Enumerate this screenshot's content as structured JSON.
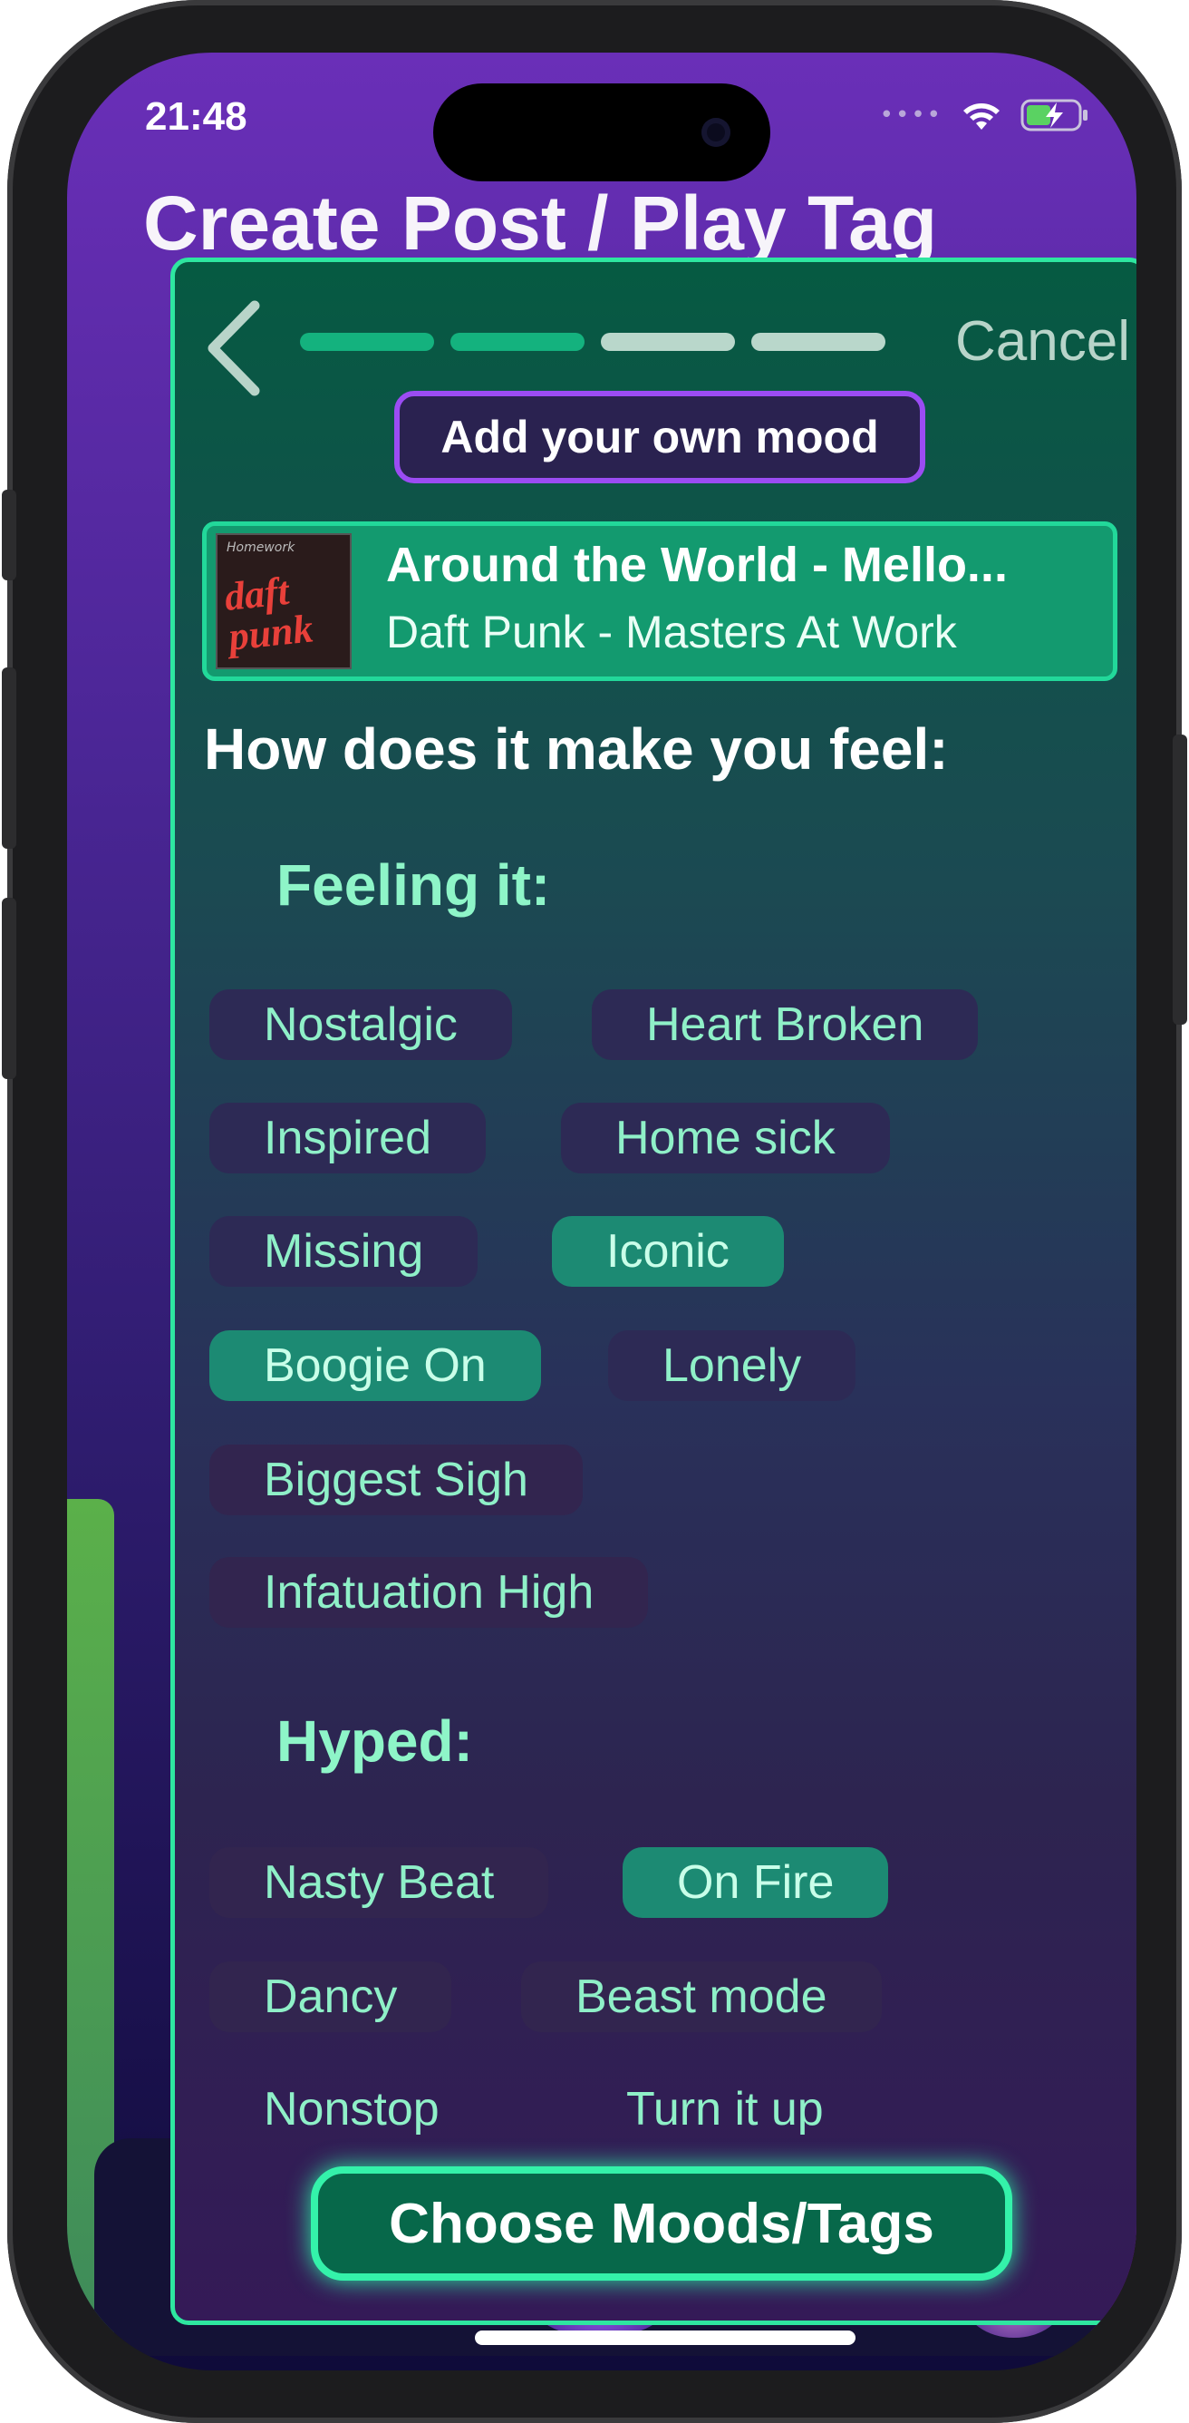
{
  "status_bar": {
    "time": "21:48"
  },
  "background": {
    "title": "Create Post / Play Tag"
  },
  "modal": {
    "cancel_label": "Cancel",
    "progress": {
      "total_steps": 4,
      "completed_steps": 2
    },
    "add_mood_label": "Add your own mood",
    "song": {
      "title": "Around the World - Mello...",
      "subtitle": "Daft Punk - Masters At Work",
      "album_art_text": "daft punk"
    },
    "question": "How does it make you feel:",
    "sections": [
      {
        "title": "Feeling it:",
        "chips": [
          {
            "label": "Nostalgic",
            "selected": false
          },
          {
            "label": "Heart Broken",
            "selected": false
          },
          {
            "label": "Inspired",
            "selected": false
          },
          {
            "label": "Home sick",
            "selected": false
          },
          {
            "label": "Missing",
            "selected": false
          },
          {
            "label": "Iconic",
            "selected": true
          },
          {
            "label": "Boogie On",
            "selected": true
          },
          {
            "label": "Lonely",
            "selected": false
          },
          {
            "label": "Biggest Sigh",
            "selected": false
          },
          {
            "label": "Infatuation High",
            "selected": false
          }
        ]
      },
      {
        "title": "Hyped:",
        "chips": [
          {
            "label": "Nasty Beat",
            "selected": false
          },
          {
            "label": "On Fire",
            "selected": true
          },
          {
            "label": "Dancy",
            "selected": false
          },
          {
            "label": "Beast mode",
            "selected": false
          },
          {
            "label": "Nonstop",
            "selected": false
          },
          {
            "label": "Turn it up",
            "selected": false
          }
        ]
      }
    ],
    "choose_label": "Choose Moods/Tags"
  },
  "colors": {
    "accent": "#2ee6a0",
    "selected_chip": "#1c8a73",
    "chip": "#2d2a55",
    "add_mood_border": "#9b4cf3"
  }
}
